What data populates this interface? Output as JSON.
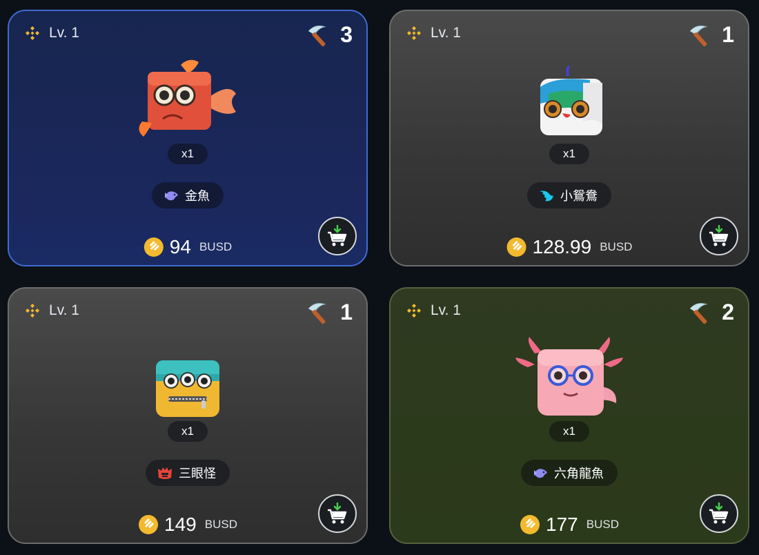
{
  "cards": [
    {
      "level": "Lv. 1",
      "mining_count": "3",
      "quantity": "x1",
      "type_name": "金魚",
      "type_icon": "fish-icon",
      "price": "94",
      "currency": "BUSD",
      "pet": "goldfish",
      "highlight": "#3f6ad0"
    },
    {
      "level": "Lv. 1",
      "mining_count": "1",
      "quantity": "x1",
      "type_name": "小鴛鴦",
      "type_icon": "wing-icon",
      "price": "128.99",
      "currency": "BUSD",
      "pet": "mandarin-duck"
    },
    {
      "level": "Lv. 1",
      "mining_count": "1",
      "quantity": "x1",
      "type_name": "三眼怪",
      "type_icon": "monster-icon",
      "price": "149",
      "currency": "BUSD",
      "pet": "three-eyed-monster"
    },
    {
      "level": "Lv. 1",
      "mining_count": "2",
      "quantity": "x1",
      "type_name": "六角龍魚",
      "type_icon": "fish-icon",
      "price": "177",
      "currency": "BUSD",
      "pet": "axolotl"
    }
  ],
  "colors": {
    "coin": "#f3ba2f",
    "cart_green": "#46d14c",
    "fish_icon": "#8f8cf2",
    "wing_icon": "#19c8f0",
    "monster_icon": "#e8453a"
  }
}
